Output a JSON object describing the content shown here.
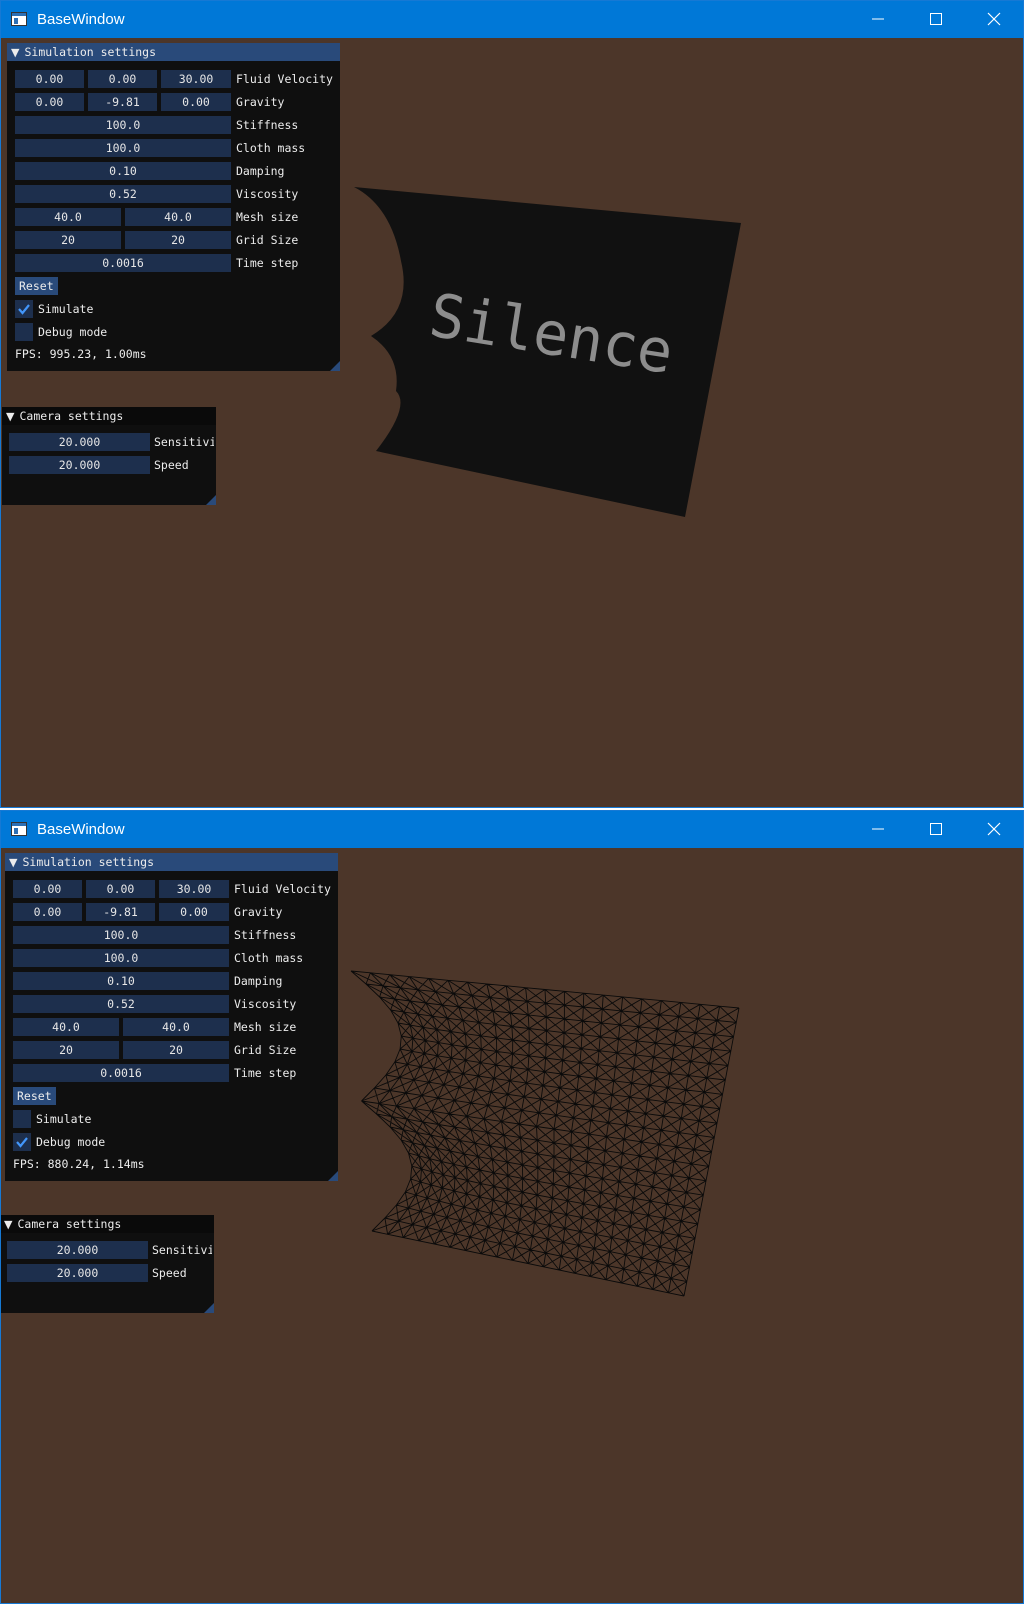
{
  "windows": [
    {
      "title": "BaseWindow",
      "cloth_text": "Silence",
      "simulation": {
        "header": "Simulation settings",
        "fluid_velocity": {
          "x": "0.00",
          "y": "0.00",
          "z": "30.00",
          "label": "Fluid Velocity"
        },
        "gravity": {
          "x": "0.00",
          "y": "-9.81",
          "z": "0.00",
          "label": "Gravity"
        },
        "stiffness": {
          "value": "100.0",
          "label": "Stiffness"
        },
        "cloth_mass": {
          "value": "100.0",
          "label": "Cloth mass"
        },
        "damping": {
          "value": "0.10",
          "label": "Damping"
        },
        "viscosity": {
          "value": "0.52",
          "label": "Viscosity"
        },
        "mesh_size": {
          "a": "40.0",
          "b": "40.0",
          "label": "Mesh size"
        },
        "grid_size": {
          "a": "20",
          "b": "20",
          "label": "Grid Size"
        },
        "time_step": {
          "value": "0.0016",
          "label": "Time step"
        },
        "reset_label": "Reset",
        "simulate": {
          "label": "Simulate",
          "checked": true
        },
        "debug_mode": {
          "label": "Debug mode",
          "checked": false
        },
        "fps": "FPS: 995.23, 1.00ms"
      },
      "camera": {
        "header": "Camera settings",
        "sensitivity": {
          "value": "20.000",
          "label": "Sensitivi"
        },
        "speed": {
          "value": "20.000",
          "label": "Speed"
        }
      }
    },
    {
      "title": "BaseWindow",
      "simulation": {
        "header": "Simulation settings",
        "fluid_velocity": {
          "x": "0.00",
          "y": "0.00",
          "z": "30.00",
          "label": "Fluid Velocity"
        },
        "gravity": {
          "x": "0.00",
          "y": "-9.81",
          "z": "0.00",
          "label": "Gravity"
        },
        "stiffness": {
          "value": "100.0",
          "label": "Stiffness"
        },
        "cloth_mass": {
          "value": "100.0",
          "label": "Cloth mass"
        },
        "damping": {
          "value": "0.10",
          "label": "Damping"
        },
        "viscosity": {
          "value": "0.52",
          "label": "Viscosity"
        },
        "mesh_size": {
          "a": "40.0",
          "b": "40.0",
          "label": "Mesh size"
        },
        "grid_size": {
          "a": "20",
          "b": "20",
          "label": "Grid Size"
        },
        "time_step": {
          "value": "0.0016",
          "label": "Time step"
        },
        "reset_label": "Reset",
        "simulate": {
          "label": "Simulate",
          "checked": false
        },
        "debug_mode": {
          "label": "Debug mode",
          "checked": true
        },
        "fps": "FPS: 880.24, 1.14ms"
      },
      "camera": {
        "header": "Camera settings",
        "sensitivity": {
          "value": "20.000",
          "label": "Sensitivi"
        },
        "speed": {
          "value": "20.000",
          "label": "Speed"
        }
      }
    }
  ],
  "colors": {
    "titlebar": "#0078d7",
    "viewport_bg": "#4c3629",
    "panel_bg": "#0f0f0f",
    "panel_header_active": "#294a7a",
    "widget_bg": "#1d2f4d",
    "cloth_fill": "#111111",
    "cloth_text": "#8d8d8d",
    "checkmark": "#4296fa"
  }
}
